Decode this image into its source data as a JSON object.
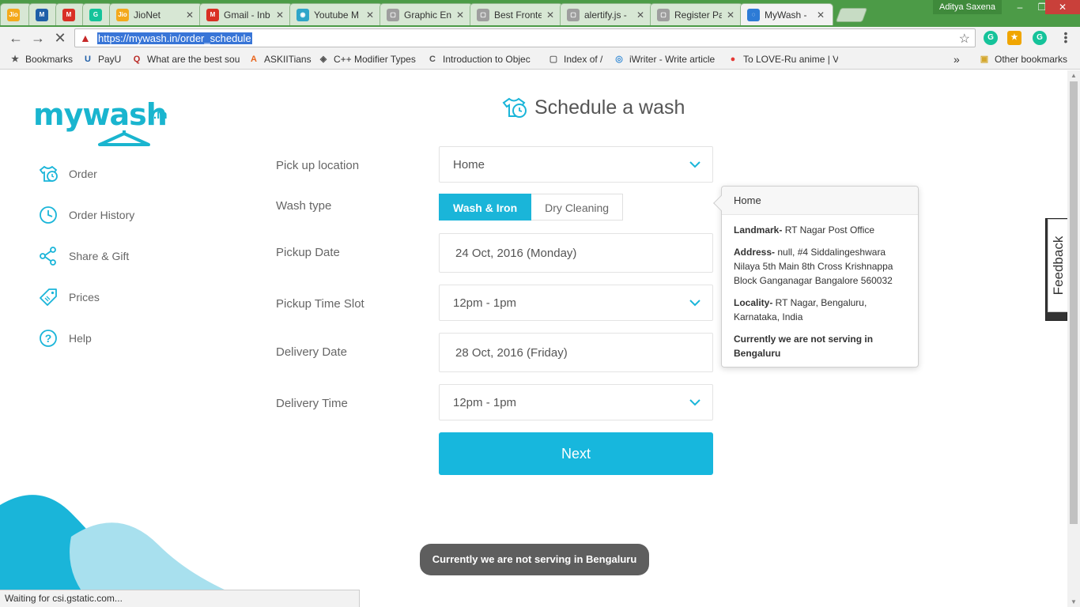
{
  "browser": {
    "profile_name": "Aditya Saxena",
    "tabs": [
      {
        "title": "",
        "icon": "jio-icon",
        "color": "#f4a91b",
        "abbr": "Jio"
      },
      {
        "title": "",
        "icon": "m-icon",
        "color": "#1f5fa8",
        "abbr": "M"
      },
      {
        "title": "",
        "icon": "gmail-icon",
        "color": "#d93025",
        "abbr": "M"
      },
      {
        "title": "",
        "icon": "grammarly-icon",
        "color": "#15c39a",
        "abbr": "G"
      },
      {
        "title": "JioNet",
        "icon": "jio-icon",
        "color": "#f4a91b",
        "abbr": "Jio"
      },
      {
        "title": "Gmail - Inb",
        "icon": "gmail-icon",
        "color": "#d93025",
        "abbr": "M"
      },
      {
        "title": "Youtube M",
        "icon": "youtube-icon",
        "color": "#2fa5c9",
        "abbr": "◉"
      },
      {
        "title": "Graphic En",
        "icon": "page-icon",
        "color": "#9e9e9e",
        "abbr": "▢"
      },
      {
        "title": "Best Fronte",
        "icon": "page-icon",
        "color": "#9e9e9e",
        "abbr": "▢"
      },
      {
        "title": "alertify.js -",
        "icon": "page-icon",
        "color": "#9e9e9e",
        "abbr": "▢"
      },
      {
        "title": "Register Pa",
        "icon": "page-icon",
        "color": "#9e9e9e",
        "abbr": "▢"
      },
      {
        "title": "MyWash -",
        "icon": "loading-icon",
        "color": "#2d7bd6",
        "abbr": "◌",
        "active": true
      }
    ],
    "url": "https://mywash.in/order_schedule",
    "status": "Waiting for csi.gstatic.com...",
    "bookmarks": [
      {
        "label": "Bookmarks",
        "icon": "star-icon"
      },
      {
        "label": "PayU",
        "icon": "payu-icon"
      },
      {
        "label": "What are the best sou",
        "icon": "quora-icon"
      },
      {
        "label": "ASKIITians",
        "icon": "askiitians-icon"
      },
      {
        "label": "C++ Modifier Types",
        "icon": "cpp-icon"
      },
      {
        "label": "Introduction to Objec",
        "icon": "doc-icon"
      },
      {
        "label": "Index of /",
        "icon": "page-icon"
      },
      {
        "label": "iWriter - Write article",
        "icon": "iwriter-icon"
      },
      {
        "label": "To LOVE-Ru anime | V",
        "icon": "anime-icon"
      }
    ],
    "bookmarks_more": "»",
    "other_bookmarks": "Other bookmarks"
  },
  "app": {
    "logo_word": "mywash",
    "logo_tld": ".in",
    "accent": "#1ab5d9",
    "sidebar": [
      {
        "label": "Order",
        "icon": "tshirt-icon"
      },
      {
        "label": "Order History",
        "icon": "clock-icon"
      },
      {
        "label": "Share & Gift",
        "icon": "share-icon"
      },
      {
        "label": "Prices",
        "icon": "price-tag-icon"
      },
      {
        "label": "Help",
        "icon": "help-icon"
      }
    ],
    "heading": "Schedule a wash",
    "form": {
      "pickup_location_label": "Pick up location",
      "pickup_location_value": "Home",
      "wash_type_label": "Wash type",
      "wash_type_options": [
        "Wash & Iron",
        "Dry Cleaning"
      ],
      "wash_type_selected": "Wash & Iron",
      "pickup_date_label": "Pickup Date",
      "pickup_date_value": "24 Oct, 2016  (Monday)",
      "pickup_slot_label": "Pickup Time Slot",
      "pickup_slot_value": "12pm - 1pm",
      "delivery_date_label": "Delivery Date",
      "delivery_date_value": "28 Oct, 2016  (Friday)",
      "delivery_time_label": "Delivery Time",
      "delivery_time_value": "12pm - 1pm",
      "next_label": "Next"
    },
    "popover": {
      "title": "Home",
      "landmark_label": "Landmark-",
      "landmark_value": " RT Nagar Post Office",
      "address_label": "Address-",
      "address_value": " null, #4 Siddalingeshwara Nilaya 5th Main 8th Cross Krishnappa Block Ganganagar Bangalore 560032",
      "locality_label": "Locality-",
      "locality_value": " RT Nagar, Bengaluru, Karnataka, India",
      "notice": "Currently we are not serving in Bengaluru"
    },
    "feedback_label": "Feedback",
    "toast": "Currently we are not serving in Bengaluru"
  }
}
